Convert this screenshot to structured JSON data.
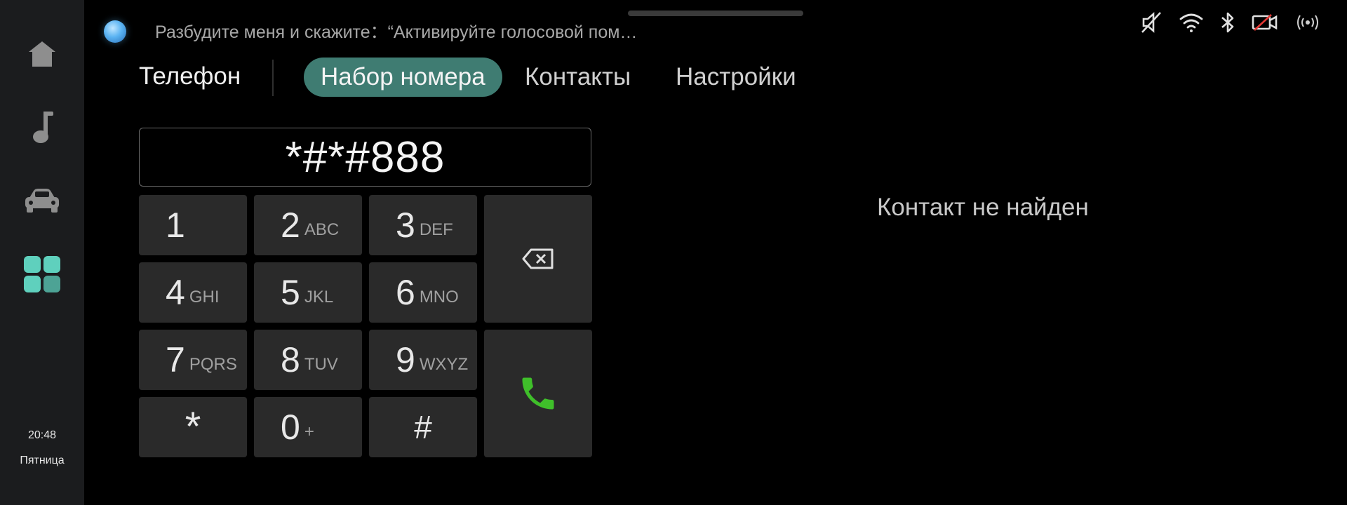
{
  "sidebar": {
    "items": [
      {
        "name": "home",
        "icon": "home-icon"
      },
      {
        "name": "music",
        "icon": "music-note-icon"
      },
      {
        "name": "car",
        "icon": "car-icon"
      },
      {
        "name": "apps",
        "icon": "apps-grid-icon"
      }
    ],
    "time": "20:48",
    "day": "Пятница"
  },
  "status_bar": {
    "voice_hint": "Разбудите меня и скажите：“Активируйте голосовой пом…",
    "icons": [
      "mute-icon",
      "wifi-icon",
      "bluetooth-icon",
      "camera-off-icon",
      "signal-broadcast-icon"
    ]
  },
  "header": {
    "title": "Телефон",
    "tabs": [
      {
        "label": "Набор номера",
        "active": true
      },
      {
        "label": "Контакты",
        "active": false
      },
      {
        "label": "Настройки",
        "active": false
      }
    ]
  },
  "dialer": {
    "number": "*#*#888",
    "keys": [
      {
        "digit": "1",
        "letters": ""
      },
      {
        "digit": "2",
        "letters": "ABC"
      },
      {
        "digit": "3",
        "letters": "DEF"
      },
      {
        "digit": "4",
        "letters": "GHI"
      },
      {
        "digit": "5",
        "letters": "JKL"
      },
      {
        "digit": "6",
        "letters": "MNO"
      },
      {
        "digit": "7",
        "letters": "PQRS"
      },
      {
        "digit": "8",
        "letters": "TUV"
      },
      {
        "digit": "9",
        "letters": "WXYZ"
      },
      {
        "digit": "*",
        "letters": ""
      },
      {
        "digit": "0",
        "letters": "+"
      },
      {
        "digit": "#",
        "letters": ""
      }
    ],
    "backspace_icon": "backspace-icon",
    "call_icon": "phone-call-icon"
  },
  "results": {
    "empty_text": "Контакт не найден"
  },
  "colors": {
    "accent_tab": "#3f7c72",
    "apps_icon": "#5fd0bd",
    "call_green": "#3fbf2a",
    "voice_blue": "#5ab3f2"
  }
}
